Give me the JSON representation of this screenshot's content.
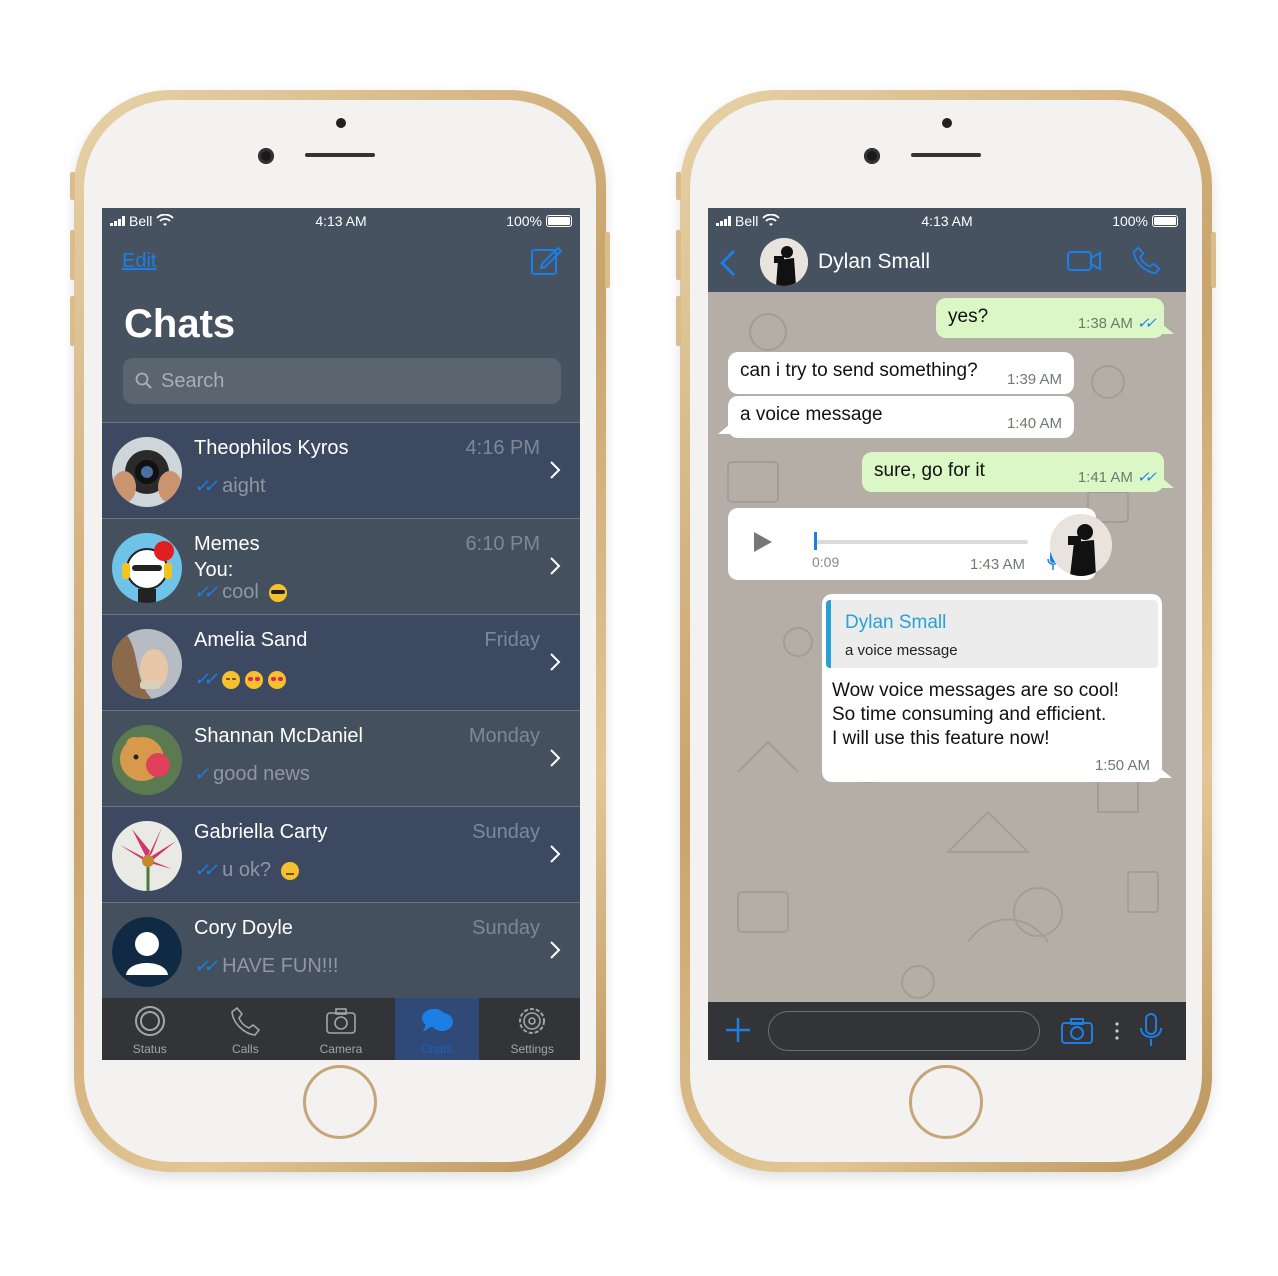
{
  "left_phone": {
    "status": {
      "carrier": "Bell",
      "time": "4:13 AM",
      "battery": "100%"
    },
    "header": {
      "edit": "Edit",
      "title": "Chats",
      "search_placeholder": "Search"
    },
    "chats": [
      {
        "name": "Theophilos Kyros",
        "time": "4:16 PM",
        "preview": "aight",
        "ticks": "✓✓",
        "emojis": []
      },
      {
        "name": "Memes",
        "time": "6:10 PM",
        "sub": "You:",
        "preview": "cool",
        "ticks": "✓✓",
        "emojis": [
          "sunglasses"
        ]
      },
      {
        "name": "Amelia Sand",
        "time": "Friday",
        "preview": "",
        "ticks": "✓✓",
        "emojis": [
          "blush",
          "heart-eyes",
          "heart-eyes"
        ]
      },
      {
        "name": "Shannan McDaniel",
        "time": "Monday",
        "preview": "good news",
        "ticks": "✓",
        "emojis": []
      },
      {
        "name": "Gabriella Carty",
        "time": "Sunday",
        "preview": "u ok?",
        "ticks": "✓✓",
        "emojis": [
          "neutral-face"
        ]
      },
      {
        "name": "Cory Doyle",
        "time": "Sunday",
        "preview": "HAVE FUN!!!",
        "ticks": "✓✓",
        "emojis": []
      }
    ],
    "tabs": [
      {
        "label": "Status",
        "icon": "status-icon"
      },
      {
        "label": "Calls",
        "icon": "calls-icon"
      },
      {
        "label": "Camera",
        "icon": "camera-icon"
      },
      {
        "label": "Chats",
        "icon": "chats-icon",
        "active": true
      },
      {
        "label": "Settings",
        "icon": "settings-icon"
      }
    ]
  },
  "right_phone": {
    "status": {
      "carrier": "Bell",
      "time": "4:13 AM",
      "battery": "100%"
    },
    "contact_name": "Dylan Small",
    "messages": [
      {
        "dir": "out",
        "text": "yes?",
        "time": "1:38 AM",
        "ticks": "✓✓"
      },
      {
        "dir": "in",
        "text": "can i try to send something?",
        "time": "1:39 AM"
      },
      {
        "dir": "in",
        "text": "a voice message",
        "time": "1:40 AM"
      },
      {
        "dir": "out",
        "text": "sure, go for it",
        "time": "1:41 AM",
        "ticks": "✓✓"
      }
    ],
    "voice": {
      "duration": "0:09",
      "time": "1:43 AM",
      "progress": 0.0
    },
    "reply": {
      "quote_name": "Dylan Small",
      "quote_text": "a voice message",
      "lines": [
        "Wow voice messages are so cool!",
        "So time consuming and efficient.",
        "I will use this feature now!"
      ],
      "time": "1:50 AM"
    },
    "input_placeholder": ""
  },
  "colors": {
    "accent": "#1d7fe6",
    "header_bg": "#465260",
    "row_dark": "#3c4961",
    "row_light": "#45505e",
    "out_bubble": "#dcf7c6",
    "quote_bar": "#2aa1d4"
  }
}
